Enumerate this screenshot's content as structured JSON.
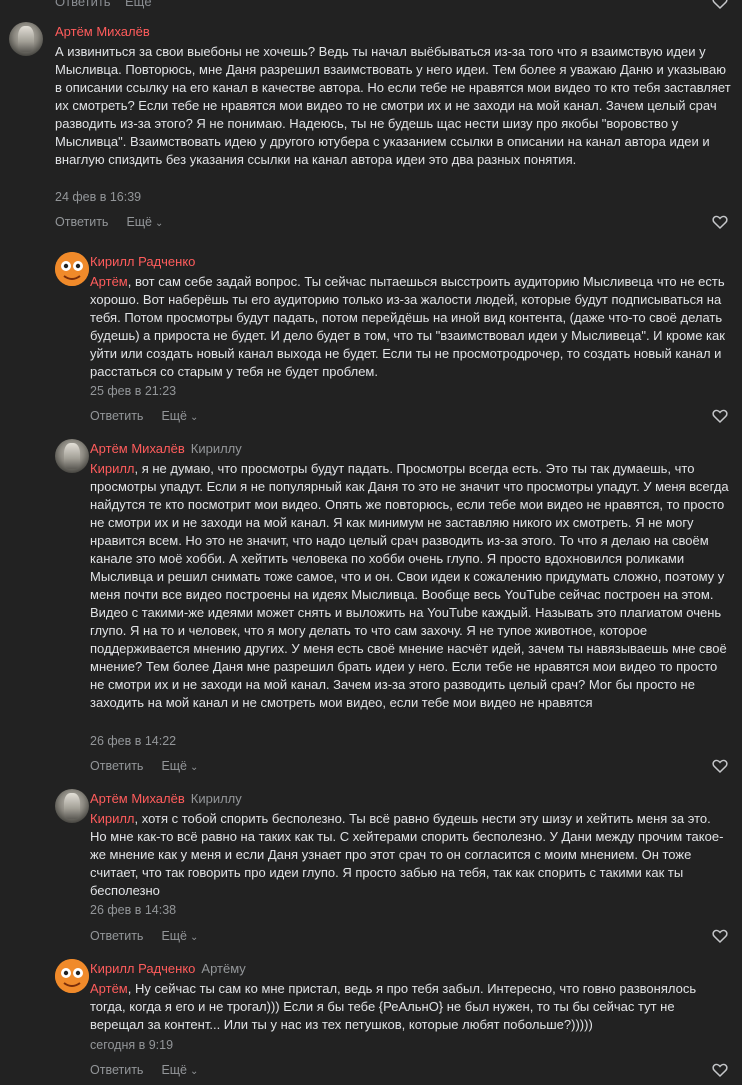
{
  "top_strip": {
    "reply_label": "Ответить",
    "more_label": "Ещё"
  },
  "comments": [
    {
      "author": "Артём Михалёв",
      "reply_to": "",
      "mention": "",
      "text": "А извиниться за свои выебоны не хочешь? Ведь ты начал выёбываться из-за того что я взаимствую идеи у Мысливца. Повторюсь, мне Даня разрешил взаимствовать у него идеи. Тем более я уважаю Даню и указываю в описании ссылку на его канал в качестве автора. Но если тебе не нравятся мои видео то кто тебя заставляет их смотреть? Если тебе не нравятся мои видео то не смотри их и не заходи на мой канал. Зачем целый срач разводить из-за этого? Я не понимаю. Надеюсь, ты не будешь щас нести шизу про якобы \"воровство у Мысливца\". Взаимствовать идею у другого ютубера с указанием ссылки в описании на канал автора идеи и внаглую спиздить без указания ссылки на канал автора идеи это два разных понятия.",
      "date": "24 фев в 16:39",
      "reply_label": "Ответить",
      "more_label": "Ещё"
    },
    {
      "author": "Кирилл Радченко",
      "reply_to": "",
      "mention": "Артём",
      "text": ", вот сам себе задай вопрос. Ты сейчас пытаешься выcстроить аудиторию Мысливеца что не есть хорошо. Вот наберёшь ты его аудиторию только из-за жалости людей, которые будут подписываться на тебя. Потом просмотры будут падать, потом перейдёшь на иной вид контента, (даже что-то своё делать будешь) а прироста не будет. И дело будет в том, что ты \"взаимствовал идеи у Мысливеца\". И кроме как уйти или создать новый канал выхода не будет. Если ты не просмотродрочер, то создать новый канал и расстаться со старым у тебя не будет проблем.",
      "date": "25 фев в 21:23",
      "reply_label": "Ответить",
      "more_label": "Ещё"
    },
    {
      "author": "Артём Михалёв",
      "reply_to": "Кириллу",
      "mention": "Кирилл",
      "text": ", я не думаю, что просмотры будут падать. Просмотры всегда есть. Это ты так думаешь, что просмотры упадут. Если я не популярный как Даня то это не значит что просмотры упадут. У меня всегда найдутся те кто посмотрит мои видео. Опять же повторюсь, если тебе мои видео не нравятся, то просто не смотри их и не заходи на мой канал. Я как минимум не заставляю никого их смотреть. Я не могу нравится всем. Но это не значит, что надо целый срач разводить из-за этого. То что я делаю на своём канале это моё хобби. А хейтить человека по хобби очень глупо. Я просто вдохновился роликами Мысливца и решил снимать тоже самое, что и он. Свои идеи к сожалению придумать сложно, поэтому у меня почти все видео построены на идеях Мысливца. Вообще весь YouTube сейчас построен на этом. Видео с такими-же идеями может снять и выложить на YouTube каждый. Называть это плагиатом очень глупо. Я на то и человек, что я могу делать то что сам захочу. Я не тупое животное, которое поддерживается мнению других. У меня есть своё мнение насчёт идей, зачем ты навязываешь мне своё мнение? Тем более Даня мне разрешил брать идеи у него. Если тебе не нравятся мои видео то просто не смотри их и не заходи на мой канал. Зачем из-за этого разводить целый срач? Мог бы просто не заходить на мой канал и не смотреть мои видео, если тебе мои видео не нравятся",
      "date": "26 фев в 14:22",
      "reply_label": "Ответить",
      "more_label": "Ещё"
    },
    {
      "author": "Артём Михалёв",
      "reply_to": "Кириллу",
      "mention": "Кирилл",
      "text": ", хотя с тобой спорить бесполезно. Ты всё равно будешь нести эту шизу и хейтить меня за это. Но мне как-то всё равно на таких как ты. С хейтерами спорить бесполезно. У Дани между прочим такое-же мнение как у меня и если Даня узнает про этот срач то он согласится с моим мнением. Он тоже считает, что так говорить про идеи глупо. Я просто забью на тебя, так как спорить с такими как ты бесполезно",
      "date": "26 фев в 14:38",
      "reply_label": "Ответить",
      "more_label": "Ещё"
    },
    {
      "author": "Кирилл Радченко",
      "reply_to": "Артёму",
      "mention": "Артём",
      "text": ", Ну сейчас ты сам ко мне пристал, ведь я про тебя забыл. Интересно, что говно развонялось тогда, когда я его и не трогал))) Если я бы тебе {РеАльнО} не был нужен, то ты бы сейчас тут не верещал за контент... Или ты у нас из тех петушков, которые любят побольше?)))))",
      "date": "сегодня в 9:19",
      "reply_label": "Ответить",
      "more_label": "Ещё"
    }
  ],
  "colors": {
    "background": "#222222",
    "text": "#e1e3e6",
    "accent_name": "#ff5c5c",
    "muted": "#939699"
  },
  "icons": [
    "heart-icon",
    "chevron-down-icon",
    "avatar-photo",
    "avatar-orange-cartoon"
  ]
}
